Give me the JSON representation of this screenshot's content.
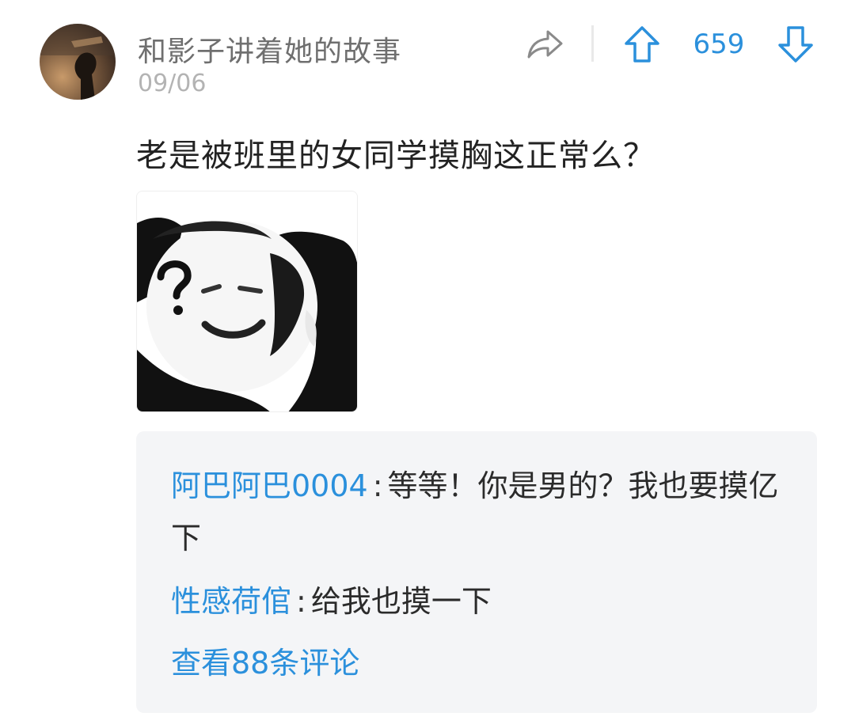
{
  "post": {
    "author": "和影子讲着她的故事",
    "date": "09/06",
    "vote_count": "659",
    "text": "老是被班里的女同学摸胸这正常么？",
    "image_description": "meme-face"
  },
  "comments": [
    {
      "name": "阿巴阿巴0004",
      "separator": ":",
      "text": "等等！你是男的？我也要摸亿下"
    },
    {
      "name": "性感荷倌",
      "separator": ":",
      "text": "给我也摸一下"
    }
  ],
  "view_all_label": "查看88条评论",
  "icons": {
    "share": "share-icon",
    "upvote": "arrow-up-icon",
    "downvote": "arrow-down-icon"
  },
  "colors": {
    "accent": "#2b90dc",
    "username": "#6f6f6f",
    "date": "#b3b3b3",
    "comment_bg": "#f4f5f7"
  }
}
